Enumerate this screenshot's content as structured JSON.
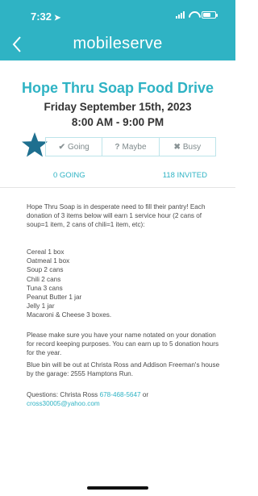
{
  "status_bar": {
    "time": "7:32"
  },
  "header": {
    "title": "mobileserve"
  },
  "event": {
    "title": "Hope Thru Soap Food Drive",
    "date": "Friday September 15th, 2023",
    "time": "8:00 AM - 9:00 PM"
  },
  "rsvp": {
    "going": {
      "icon": "✔",
      "label": "Going"
    },
    "maybe": {
      "icon": "?",
      "label": "Maybe"
    },
    "busy": {
      "icon": "✖",
      "label": "Busy"
    }
  },
  "counts": {
    "going": "0 GOING",
    "invited": "118 INVITED"
  },
  "description": {
    "intro": "Hope Thru Soap is in desperate need to fill their pantry! Each donation of 3 items below will earn 1 service hour (2 cans of soup=1 item, 2 cans of chili=1 item, etc):",
    "items": [
      "Cereal 1 box",
      "Oatmeal 1 box",
      "Soup 2 cans",
      "Chili 2 cans",
      "Tuna 3 cans",
      "Peanut Butter 1 jar",
      "Jelly 1 jar",
      "Macaroni & Cheese 3 boxes."
    ],
    "note": "Please make sure you have your name notated on your donation for record keeping purposes. You can earn up to 5 donation hours for the year.",
    "bin": "Blue bin will be out at Christa Ross and Addison Freeman's house by the garage: 2555 Hamptons Run.",
    "questions_prefix": "Questions: Christa Ross ",
    "phone": "678-468-5647",
    "or": " or",
    "email": "cross30005@yahoo.com"
  },
  "colors": {
    "accent": "#2fb3c4",
    "star": "#1e6f8f"
  },
  "icons": {
    "back": "chevron-left-icon",
    "star": "star-icon",
    "location": "location-arrow-icon"
  }
}
